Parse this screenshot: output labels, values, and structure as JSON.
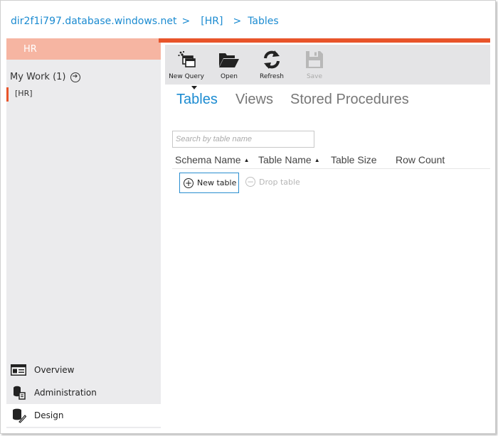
{
  "breadcrumb": {
    "server": "dir2f1i797.database.windows.net",
    "database": "[HR]",
    "section": "Tables",
    "separator": ">"
  },
  "left_panel": {
    "db_header": "HR",
    "my_work_label": "My Work (1)",
    "my_work_items": [
      "[HR]"
    ],
    "nav": [
      {
        "label": "Overview",
        "icon": "overview-icon"
      },
      {
        "label": "Administration",
        "icon": "administration-icon"
      },
      {
        "label": "Design",
        "icon": "design-icon",
        "active": true
      }
    ]
  },
  "toolbar": {
    "buttons": [
      {
        "label": "New Query",
        "icon": "new-query-icon",
        "enabled": true
      },
      {
        "label": "Open",
        "icon": "folder-open-icon",
        "enabled": true
      },
      {
        "label": "Refresh",
        "icon": "refresh-icon",
        "enabled": true
      },
      {
        "label": "Save",
        "icon": "save-icon",
        "enabled": false
      }
    ]
  },
  "tabs": [
    {
      "label": "Tables",
      "active": true
    },
    {
      "label": "Views",
      "active": false
    },
    {
      "label": "Stored Procedures",
      "active": false
    }
  ],
  "search": {
    "placeholder": "Search by table name",
    "value": ""
  },
  "table": {
    "columns": [
      {
        "label": "Schema Name",
        "sorted": "asc"
      },
      {
        "label": "Table Name",
        "sorted": "asc"
      },
      {
        "label": "Table Size"
      },
      {
        "label": "Row Count"
      }
    ],
    "rows": []
  },
  "actions": {
    "new_table": "New table",
    "drop_table": "Drop table"
  },
  "colors": {
    "accent": "#e8542a",
    "accent_light": "#f6b5a2",
    "link": "#1b8bd1",
    "panel_bg": "#ebebed",
    "toolbar_bg": "#e4e4e6"
  }
}
